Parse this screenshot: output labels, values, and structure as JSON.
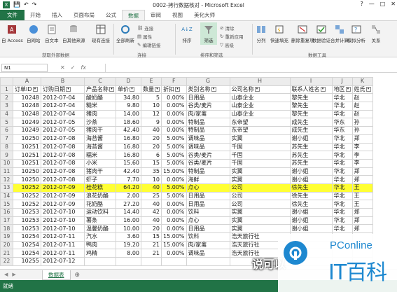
{
  "window": {
    "title": "0002-拷行数据核对 - Microsoft Excel"
  },
  "qat": {
    "save": "💾",
    "undo": "↶",
    "redo": "↷"
  },
  "tabs": [
    "文件",
    "开始",
    "插入",
    "页面布局",
    "公式",
    "数据",
    "审阅",
    "视图",
    "美化大师"
  ],
  "ribbon": {
    "groups": {
      "external": "获取外部数据",
      "connections": "连接",
      "sort_filter": "排序和筛选",
      "tools": "数据工具"
    },
    "buttons": {
      "access": "自 Access",
      "web": "自网站",
      "text": "自文本",
      "other": "自其他来源",
      "existing": "现有连接",
      "refresh": "全部刷新",
      "connections": "连接",
      "properties": "属性",
      "editlinks": "编辑链接",
      "sort_az": "A↓Z",
      "sort": "排序",
      "filter": "筛选",
      "clear": "清除",
      "reapply": "重新应用",
      "advanced": "高级",
      "split": "分列",
      "flashfill": "快速填充",
      "dedup": "删除重复项",
      "validation": "数据验证",
      "consolidate": "合并计算",
      "whatif": "模拟分析",
      "relations": "关系"
    }
  },
  "formula_bar": {
    "name_box": "N1",
    "fx": "fx",
    "cancel": "✕",
    "enter": "✓"
  },
  "columns": [
    "A",
    "B",
    "C",
    "D",
    "E",
    "F",
    "G",
    "H",
    "I",
    "J",
    "K"
  ],
  "header_row": [
    "订单ID",
    "订购日期",
    "产品名称",
    "单价",
    "数量",
    "折扣",
    "类别名称",
    "公司名称",
    "联系人姓名",
    "地区",
    "姓氏"
  ],
  "rows": [
    [
      "10248",
      "2012-07-04",
      "酸奶酪",
      "34.80",
      "5",
      "0.00%",
      "日用品",
      "山泰企业",
      "黎先生",
      "华北",
      "赵"
    ],
    [
      "10248",
      "2012-07-04",
      "糙米",
      "9.80",
      "10",
      "0.00%",
      "谷类/麦片",
      "山泰企业",
      "黎先生",
      "华北",
      "赵"
    ],
    [
      "10248",
      "2012-07-04",
      "猪肉",
      "14.00",
      "12",
      "0.00%",
      "肉/家禽",
      "山泰企业",
      "黎先生",
      "华北",
      "赵"
    ],
    [
      "10249",
      "2012-07-05",
      "沙茶",
      "18.60",
      "9",
      "0.00%",
      "特制品",
      "东帝望",
      "成先生",
      "华东",
      "孙"
    ],
    [
      "10249",
      "2012-07-05",
      "猪肉干",
      "42.40",
      "40",
      "0.00%",
      "特制品",
      "东帝望",
      "成先生",
      "华东",
      "孙"
    ],
    [
      "10250",
      "2012-07-08",
      "海苔酱",
      "16.80",
      "20",
      "5.00%",
      "调味品",
      "实翼",
      "谢小姐",
      "华北",
      "郑"
    ],
    [
      "10251",
      "2012-07-08",
      "海苔酱",
      "16.80",
      "20",
      "5.00%",
      "调味品",
      "千固",
      "苏先生",
      "华北",
      "李"
    ],
    [
      "10251",
      "2012-07-08",
      "糯米",
      "16.80",
      "6",
      "5.00%",
      "谷类/麦片",
      "千固",
      "苏先生",
      "华北",
      "李"
    ],
    [
      "10251",
      "2012-07-08",
      "小米",
      "15.60",
      "15",
      "5.00%",
      "谷类/麦片",
      "千固",
      "苏先生",
      "华北",
      "李"
    ],
    [
      "10250",
      "2012-07-08",
      "猪肉干",
      "42.40",
      "35",
      "15.00%",
      "特制品",
      "实翼",
      "谢小姐",
      "华北",
      "郑"
    ],
    [
      "10250",
      "2012-07-08",
      "虾子",
      "7.70",
      "10",
      "0.00%",
      "海鲜",
      "实翼",
      "谢小姐",
      "华北",
      "郑"
    ],
    [
      "10252",
      "2012-07-09",
      "桂花糕",
      "64.20",
      "40",
      "5.00%",
      "点心",
      "公司",
      "徐先生",
      "华北",
      "王"
    ],
    [
      "10252",
      "2012-07-09",
      "浪花奶酪",
      "2.00",
      "25",
      "5.00%",
      "日用品",
      "公司",
      "徐先生",
      "华北",
      "王"
    ],
    [
      "10252",
      "2012-07-09",
      "花奶酪",
      "27.20",
      "40",
      "0.00%",
      "日用品",
      "公司",
      "徐先生",
      "华北",
      "王"
    ],
    [
      "10253",
      "2012-07-10",
      "运动饮料",
      "14.40",
      "42",
      "0.00%",
      "饮料",
      "实翼",
      "谢小姐",
      "华北",
      "郑"
    ],
    [
      "10253",
      "2012-07-10",
      "薯条",
      "16.00",
      "40",
      "0.00%",
      "点心",
      "实翼",
      "谢小姐",
      "华北",
      "郑"
    ],
    [
      "10253",
      "2012-07-10",
      "温馨奶酪",
      "10.00",
      "20",
      "0.00%",
      "日用品",
      "实翼",
      "谢小姐",
      "华北",
      "郑"
    ],
    [
      "10254",
      "2012-07-11",
      "汽水",
      "3.60",
      "15",
      "15.00%",
      "饮料",
      "浩天旅行社",
      "",
      "",
      ""
    ],
    [
      "10254",
      "2012-07-11",
      "鸭肉",
      "19.20",
      "21",
      "15.00%",
      "肉/家禽",
      "浩天旅行社",
      "",
      "",
      ""
    ],
    [
      "10254",
      "2012-07-11",
      "鸡精",
      "8.00",
      "21",
      "0.00%",
      "调味品",
      "浩天旅行社",
      "",
      "",
      ""
    ],
    [
      "10255",
      "2012-07-12",
      "",
      "",
      "",
      "",
      "",
      "",
      "",
      "",
      ""
    ]
  ],
  "row_numbers": [
    "1",
    "2",
    "3",
    "4",
    "5",
    "6",
    "7",
    "8",
    "9",
    "10",
    "11",
    "12",
    "13",
    "14",
    "15",
    "16",
    "17",
    "18",
    "19",
    "20",
    "21",
    "22"
  ],
  "sheet": {
    "name": "数据表",
    "add": "⊕"
  },
  "status": {
    "text": "就绪"
  },
  "overlay": {
    "caption": "说可以",
    "watermark_top": "PConline",
    "watermark_main": "IT百科"
  },
  "colors": {
    "excel_green": "#217346",
    "highlight": "#ffff33",
    "watermark_blue": "#1e88d0"
  }
}
